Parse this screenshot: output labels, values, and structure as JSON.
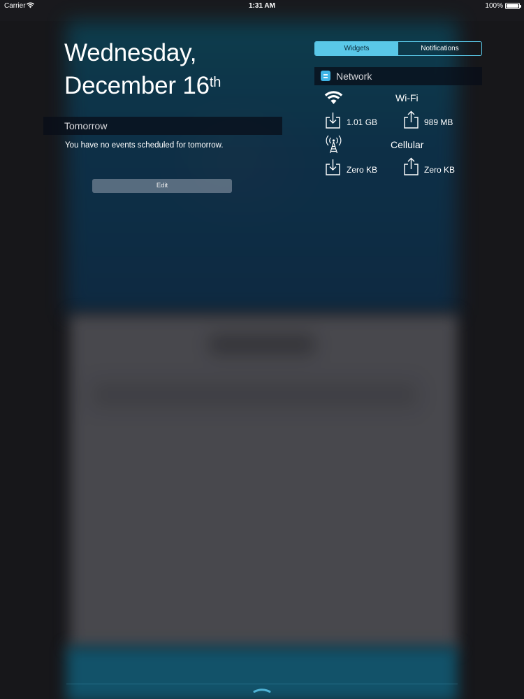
{
  "status_bar": {
    "carrier": "Carrier",
    "time": "1:31 AM",
    "battery_percent": "100%",
    "battery_level": 1.0
  },
  "date": {
    "weekday": "Wednesday,",
    "month_day": "December 16",
    "ordinal_suffix": "th"
  },
  "tabs": {
    "widgets": "Widgets",
    "notifications": "Notifications",
    "active": "widgets"
  },
  "calendar": {
    "header": "Tomorrow",
    "message": "You have no events scheduled for tomorrow.",
    "edit_label": "Edit"
  },
  "network": {
    "title": "Network",
    "wifi": {
      "label": "Wi-Fi",
      "download": "1.01 GB",
      "upload": "989 MB"
    },
    "cellular": {
      "label": "Cellular",
      "download": "Zero KB",
      "upload": "Zero KB"
    }
  },
  "colors": {
    "accent": "#5ac8e8",
    "app_icon": "#3fb4e6"
  },
  "icons": [
    "wifi-icon",
    "cellular-tower-icon",
    "download-icon",
    "upload-icon",
    "battery-icon",
    "chevron-up-icon"
  ]
}
